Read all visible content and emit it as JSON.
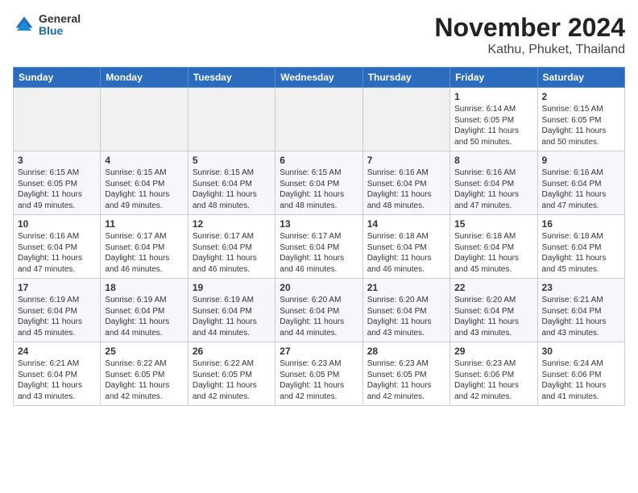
{
  "header": {
    "logo": {
      "general": "General",
      "blue": "Blue"
    },
    "title": "November 2024",
    "subtitle": "Kathu, Phuket, Thailand"
  },
  "weekdays": [
    "Sunday",
    "Monday",
    "Tuesday",
    "Wednesday",
    "Thursday",
    "Friday",
    "Saturday"
  ],
  "weeks": [
    [
      {
        "day": "",
        "info": ""
      },
      {
        "day": "",
        "info": ""
      },
      {
        "day": "",
        "info": ""
      },
      {
        "day": "",
        "info": ""
      },
      {
        "day": "",
        "info": ""
      },
      {
        "day": "1",
        "info": "Sunrise: 6:14 AM\nSunset: 6:05 PM\nDaylight: 11 hours and 50 minutes."
      },
      {
        "day": "2",
        "info": "Sunrise: 6:15 AM\nSunset: 6:05 PM\nDaylight: 11 hours and 50 minutes."
      }
    ],
    [
      {
        "day": "3",
        "info": "Sunrise: 6:15 AM\nSunset: 6:05 PM\nDaylight: 11 hours and 49 minutes."
      },
      {
        "day": "4",
        "info": "Sunrise: 6:15 AM\nSunset: 6:04 PM\nDaylight: 11 hours and 49 minutes."
      },
      {
        "day": "5",
        "info": "Sunrise: 6:15 AM\nSunset: 6:04 PM\nDaylight: 11 hours and 48 minutes."
      },
      {
        "day": "6",
        "info": "Sunrise: 6:15 AM\nSunset: 6:04 PM\nDaylight: 11 hours and 48 minutes."
      },
      {
        "day": "7",
        "info": "Sunrise: 6:16 AM\nSunset: 6:04 PM\nDaylight: 11 hours and 48 minutes."
      },
      {
        "day": "8",
        "info": "Sunrise: 6:16 AM\nSunset: 6:04 PM\nDaylight: 11 hours and 47 minutes."
      },
      {
        "day": "9",
        "info": "Sunrise: 6:16 AM\nSunset: 6:04 PM\nDaylight: 11 hours and 47 minutes."
      }
    ],
    [
      {
        "day": "10",
        "info": "Sunrise: 6:16 AM\nSunset: 6:04 PM\nDaylight: 11 hours and 47 minutes."
      },
      {
        "day": "11",
        "info": "Sunrise: 6:17 AM\nSunset: 6:04 PM\nDaylight: 11 hours and 46 minutes."
      },
      {
        "day": "12",
        "info": "Sunrise: 6:17 AM\nSunset: 6:04 PM\nDaylight: 11 hours and 46 minutes."
      },
      {
        "day": "13",
        "info": "Sunrise: 6:17 AM\nSunset: 6:04 PM\nDaylight: 11 hours and 46 minutes."
      },
      {
        "day": "14",
        "info": "Sunrise: 6:18 AM\nSunset: 6:04 PM\nDaylight: 11 hours and 46 minutes."
      },
      {
        "day": "15",
        "info": "Sunrise: 6:18 AM\nSunset: 6:04 PM\nDaylight: 11 hours and 45 minutes."
      },
      {
        "day": "16",
        "info": "Sunrise: 6:18 AM\nSunset: 6:04 PM\nDaylight: 11 hours and 45 minutes."
      }
    ],
    [
      {
        "day": "17",
        "info": "Sunrise: 6:19 AM\nSunset: 6:04 PM\nDaylight: 11 hours and 45 minutes."
      },
      {
        "day": "18",
        "info": "Sunrise: 6:19 AM\nSunset: 6:04 PM\nDaylight: 11 hours and 44 minutes."
      },
      {
        "day": "19",
        "info": "Sunrise: 6:19 AM\nSunset: 6:04 PM\nDaylight: 11 hours and 44 minutes."
      },
      {
        "day": "20",
        "info": "Sunrise: 6:20 AM\nSunset: 6:04 PM\nDaylight: 11 hours and 44 minutes."
      },
      {
        "day": "21",
        "info": "Sunrise: 6:20 AM\nSunset: 6:04 PM\nDaylight: 11 hours and 43 minutes."
      },
      {
        "day": "22",
        "info": "Sunrise: 6:20 AM\nSunset: 6:04 PM\nDaylight: 11 hours and 43 minutes."
      },
      {
        "day": "23",
        "info": "Sunrise: 6:21 AM\nSunset: 6:04 PM\nDaylight: 11 hours and 43 minutes."
      }
    ],
    [
      {
        "day": "24",
        "info": "Sunrise: 6:21 AM\nSunset: 6:04 PM\nDaylight: 11 hours and 43 minutes."
      },
      {
        "day": "25",
        "info": "Sunrise: 6:22 AM\nSunset: 6:05 PM\nDaylight: 11 hours and 42 minutes."
      },
      {
        "day": "26",
        "info": "Sunrise: 6:22 AM\nSunset: 6:05 PM\nDaylight: 11 hours and 42 minutes."
      },
      {
        "day": "27",
        "info": "Sunrise: 6:23 AM\nSunset: 6:05 PM\nDaylight: 11 hours and 42 minutes."
      },
      {
        "day": "28",
        "info": "Sunrise: 6:23 AM\nSunset: 6:05 PM\nDaylight: 11 hours and 42 minutes."
      },
      {
        "day": "29",
        "info": "Sunrise: 6:23 AM\nSunset: 6:06 PM\nDaylight: 11 hours and 42 minutes."
      },
      {
        "day": "30",
        "info": "Sunrise: 6:24 AM\nSunset: 6:06 PM\nDaylight: 11 hours and 41 minutes."
      }
    ]
  ]
}
